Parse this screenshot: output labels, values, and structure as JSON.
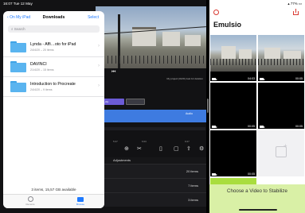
{
  "status": {
    "time": "16:07",
    "date": "Tue 12 May",
    "battery": "77%"
  },
  "files": {
    "back_label": "On My iPad",
    "title": "Downloads",
    "select_label": "Select",
    "search_placeholder": "Search",
    "items": [
      {
        "name": "Lynda - Affi…oto for iPad",
        "meta": "24/4/20 – 20 items"
      },
      {
        "name": "DAVINCI",
        "meta": "21/4/20 – 15 items"
      },
      {
        "name": "Introduction to Procreate",
        "meta": "24/4/20 – 9 items"
      }
    ],
    "footer": "3 items, 15,57 GB available",
    "tabs": {
      "recents": "Recents",
      "browse": "Browse"
    }
  },
  "editor": {
    "project_info": "My project (01/01) last 12 duration",
    "clip_label": "video_clip",
    "track_label": "Audio",
    "ruler": [
      "5:27",
      "6:03",
      "9:27"
    ],
    "section_label": "Adjustments",
    "rows": [
      {
        "count": "20 items"
      },
      {
        "count": "7 items"
      },
      {
        "count": "3 items"
      }
    ]
  },
  "emulsio": {
    "title": "Emulsio",
    "videos": [
      {
        "duration": "04:03"
      },
      {
        "duration": "00:05"
      },
      {
        "duration": "00:05"
      },
      {
        "duration": "00:05"
      },
      {
        "duration": "00:05"
      }
    ],
    "cta": "Choose a Video to Stabilize",
    "accent": "#d93a32",
    "green": "#a9dd3e"
  }
}
